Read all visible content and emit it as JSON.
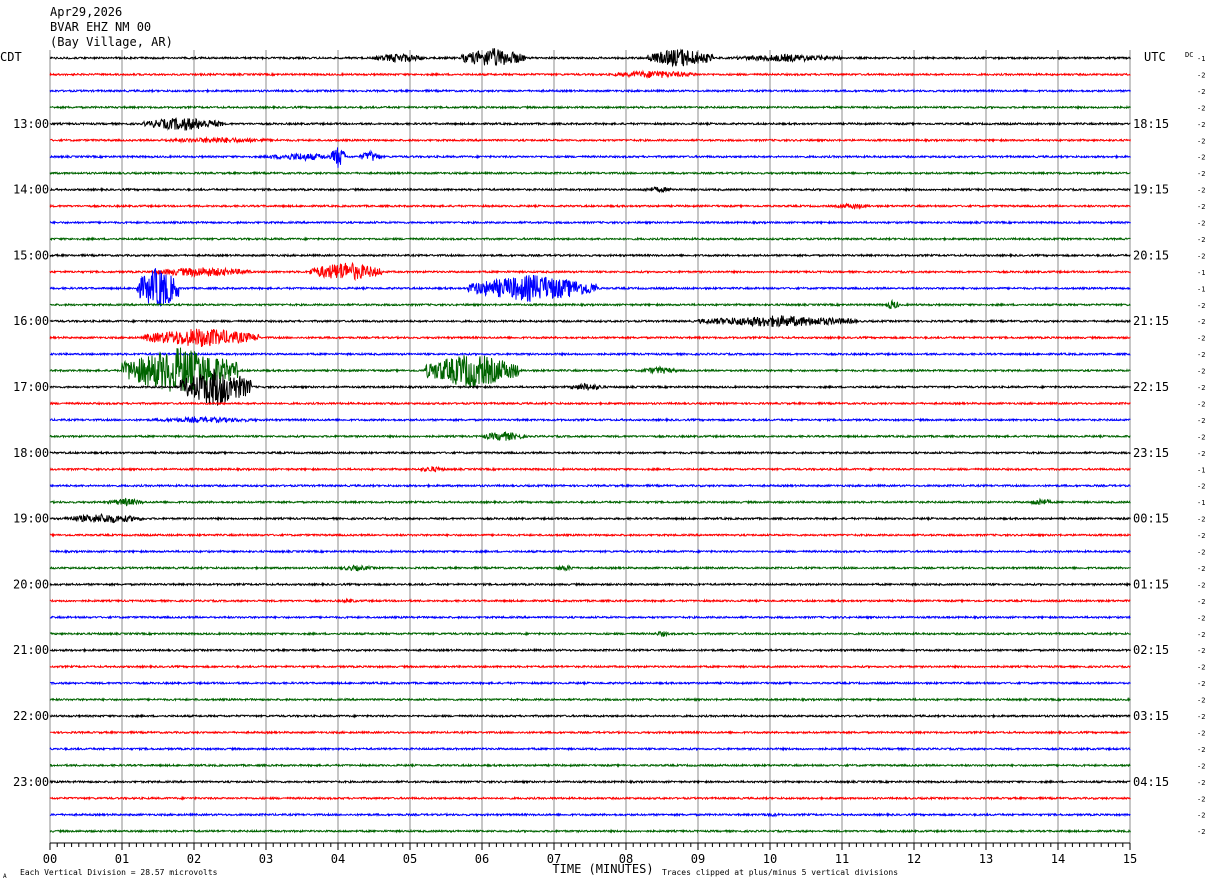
{
  "header": {
    "date": "Apr29,2026",
    "station": "BVAR EHZ NM 00",
    "location": "(Bay Village, AR)"
  },
  "left_tz": "CDT",
  "right_tz": "UTC",
  "dc_label": "DC",
  "footer": {
    "scale_note": "Each Vertical Division =   28.57 microvolts",
    "clip_note": "Traces clipped at plus/minus 5 vertical divisions",
    "corner_mark": "A"
  },
  "chart_data": {
    "type": "line",
    "title": "",
    "xlabel": "TIME (MINUTES)",
    "ylabel": "",
    "xlim": [
      0,
      15
    ],
    "x_ticks": [
      "00",
      "01",
      "02",
      "03",
      "04",
      "05",
      "06",
      "07",
      "08",
      "09",
      "10",
      "11",
      "12",
      "13",
      "14",
      "15"
    ],
    "trace_count": 48,
    "trace_interval_minutes": 15,
    "trace_colors": [
      "#000000",
      "#ff0000",
      "#0000ff",
      "#006400"
    ],
    "left_hour_labels": [
      {
        "trace": 4,
        "label": "13:00"
      },
      {
        "trace": 8,
        "label": "14:00"
      },
      {
        "trace": 12,
        "label": "15:00"
      },
      {
        "trace": 16,
        "label": "16:00"
      },
      {
        "trace": 20,
        "label": "17:00"
      },
      {
        "trace": 24,
        "label": "18:00"
      },
      {
        "trace": 28,
        "label": "19:00"
      },
      {
        "trace": 32,
        "label": "20:00"
      },
      {
        "trace": 36,
        "label": "21:00"
      },
      {
        "trace": 40,
        "label": "22:00"
      },
      {
        "trace": 44,
        "label": "23:00"
      }
    ],
    "right_hour_labels": [
      {
        "trace": 4,
        "label": "18:15"
      },
      {
        "trace": 8,
        "label": "19:15"
      },
      {
        "trace": 12,
        "label": "20:15"
      },
      {
        "trace": 16,
        "label": "21:15"
      },
      {
        "trace": 20,
        "label": "22:15"
      },
      {
        "trace": 24,
        "label": "23:15"
      },
      {
        "trace": 28,
        "label": "00:15"
      },
      {
        "trace": 32,
        "label": "01:15"
      },
      {
        "trace": 36,
        "label": "02:15"
      },
      {
        "trace": 40,
        "label": "03:15"
      },
      {
        "trace": 44,
        "label": "04:15"
      }
    ],
    "dc_offsets": [
      -1,
      -2,
      -2,
      -2,
      -2,
      -2,
      -2,
      -2,
      -2,
      -2,
      -2,
      -2,
      -2,
      -1,
      -1,
      -2,
      -2,
      -2,
      -2,
      -2,
      -2,
      -2,
      -2,
      -2,
      -2,
      -1,
      -2,
      -1,
      -2,
      -2,
      -2,
      -2,
      -2,
      -2,
      -2,
      -2,
      -2,
      -2,
      -2,
      -2,
      -2,
      -2,
      -2,
      -2,
      -2,
      -2,
      -2,
      -2
    ],
    "events": [
      {
        "trace": 0,
        "start_min": 4.5,
        "end_min": 5.2,
        "amplitude": 5
      },
      {
        "trace": 0,
        "start_min": 5.7,
        "end_min": 6.6,
        "amplitude": 10
      },
      {
        "trace": 0,
        "start_min": 8.3,
        "end_min": 9.2,
        "amplitude": 10
      },
      {
        "trace": 0,
        "start_min": 9.5,
        "end_min": 11.0,
        "amplitude": 4
      },
      {
        "trace": 1,
        "start_min": 7.8,
        "end_min": 9.0,
        "amplitude": 4
      },
      {
        "trace": 4,
        "start_min": 1.3,
        "end_min": 2.4,
        "amplitude": 7
      },
      {
        "trace": 5,
        "start_min": 1.5,
        "end_min": 3.2,
        "amplitude": 3
      },
      {
        "trace": 6,
        "start_min": 3.0,
        "end_min": 4.0,
        "amplitude": 4
      },
      {
        "trace": 6,
        "start_min": 3.9,
        "end_min": 4.1,
        "amplitude": 12
      },
      {
        "trace": 6,
        "start_min": 4.3,
        "end_min": 4.6,
        "amplitude": 6
      },
      {
        "trace": 8,
        "start_min": 8.2,
        "end_min": 8.7,
        "amplitude": 3
      },
      {
        "trace": 9,
        "start_min": 10.9,
        "end_min": 11.4,
        "amplitude": 3
      },
      {
        "trace": 13,
        "start_min": 1.4,
        "end_min": 2.8,
        "amplitude": 5
      },
      {
        "trace": 13,
        "start_min": 3.6,
        "end_min": 4.6,
        "amplitude": 10
      },
      {
        "trace": 14,
        "start_min": 1.2,
        "end_min": 1.8,
        "amplitude": 22
      },
      {
        "trace": 14,
        "start_min": 5.8,
        "end_min": 7.6,
        "amplitude": 14
      },
      {
        "trace": 15,
        "start_min": 11.6,
        "end_min": 11.8,
        "amplitude": 5
      },
      {
        "trace": 16,
        "start_min": 9.0,
        "end_min": 11.2,
        "amplitude": 6
      },
      {
        "trace": 17,
        "start_min": 1.3,
        "end_min": 2.9,
        "amplitude": 10
      },
      {
        "trace": 19,
        "start_min": 1.0,
        "end_min": 2.6,
        "amplitude": 24
      },
      {
        "trace": 19,
        "start_min": 5.2,
        "end_min": 6.5,
        "amplitude": 18
      },
      {
        "trace": 19,
        "start_min": 8.2,
        "end_min": 8.7,
        "amplitude": 4
      },
      {
        "trace": 20,
        "start_min": 1.8,
        "end_min": 2.8,
        "amplitude": 20
      },
      {
        "trace": 20,
        "start_min": 7.2,
        "end_min": 7.7,
        "amplitude": 4
      },
      {
        "trace": 22,
        "start_min": 1.4,
        "end_min": 2.9,
        "amplitude": 3
      },
      {
        "trace": 23,
        "start_min": 6.0,
        "end_min": 6.6,
        "amplitude": 5
      },
      {
        "trace": 25,
        "start_min": 5.1,
        "end_min": 5.5,
        "amplitude": 3
      },
      {
        "trace": 27,
        "start_min": 0.8,
        "end_min": 1.3,
        "amplitude": 4
      },
      {
        "trace": 27,
        "start_min": 13.6,
        "end_min": 13.9,
        "amplitude": 4
      },
      {
        "trace": 28,
        "start_min": 0.2,
        "end_min": 1.3,
        "amplitude": 5
      },
      {
        "trace": 31,
        "start_min": 4.0,
        "end_min": 4.5,
        "amplitude": 3
      },
      {
        "trace": 31,
        "start_min": 7.0,
        "end_min": 7.3,
        "amplitude": 3
      },
      {
        "trace": 33,
        "start_min": 4.0,
        "end_min": 4.3,
        "amplitude": 2
      },
      {
        "trace": 35,
        "start_min": 8.4,
        "end_min": 8.6,
        "amplitude": 3
      },
      {
        "trace": 46,
        "start_min": 9.8,
        "end_min": 10.2,
        "amplitude": 2
      }
    ]
  }
}
